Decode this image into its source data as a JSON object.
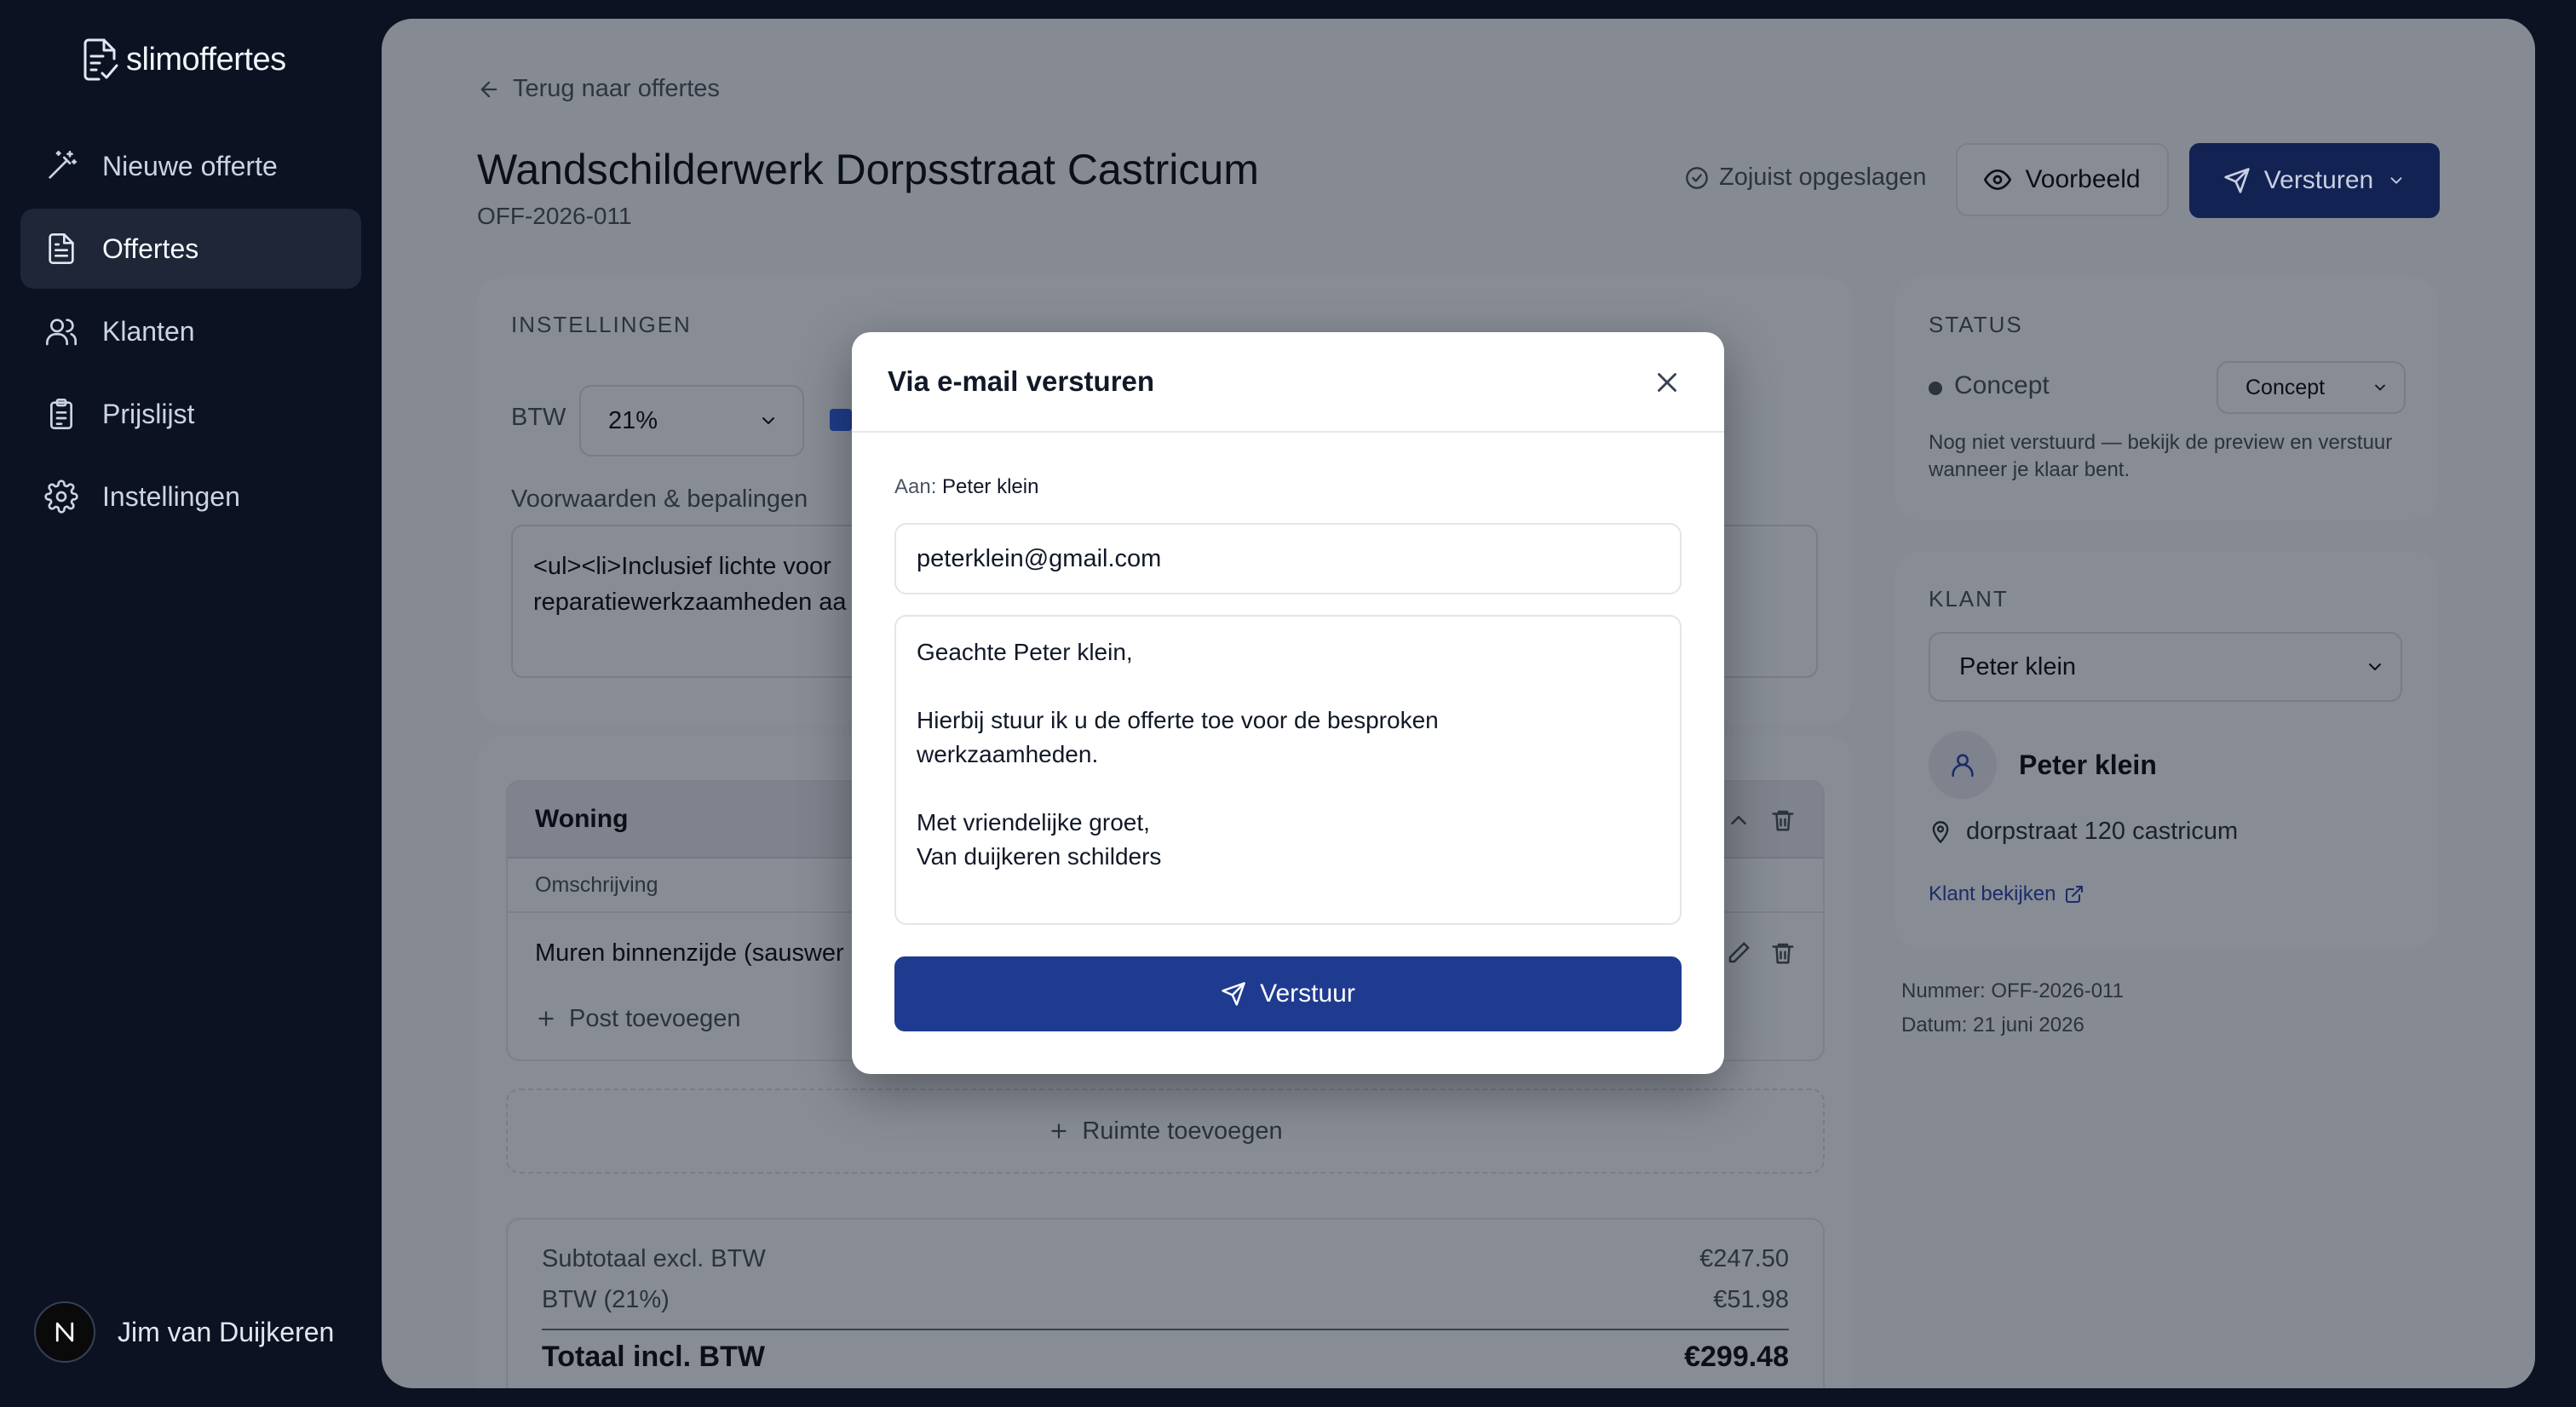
{
  "app": {
    "name": "slimoffertes"
  },
  "sidebar": {
    "items": [
      {
        "label": "Nieuwe offerte",
        "icon": "magic-wand-icon"
      },
      {
        "label": "Offertes",
        "icon": "document-icon",
        "active": true
      },
      {
        "label": "Klanten",
        "icon": "users-icon"
      },
      {
        "label": "Prijslijst",
        "icon": "clipboard-icon"
      },
      {
        "label": "Instellingen",
        "icon": "gear-icon"
      }
    ],
    "user": {
      "name": "Jim van Duijkeren",
      "avatar_letter": "N"
    }
  },
  "header": {
    "back_label": "Terug naar offertes",
    "title": "Wandschilderwerk Dorpsstraat Castricum",
    "number": "OFF-2026-011",
    "saved_status": "Zojuist opgeslagen",
    "preview_label": "Voorbeeld",
    "send_label": "Versturen"
  },
  "settings": {
    "section_label": "INSTELLINGEN",
    "btw_label": "BTW",
    "btw_value": "21%",
    "terms_label": "Voorwaarden & bepalingen",
    "terms_value": "<ul><li>Inclusief lichte voor\nreparatiewerkzaamheden aa"
  },
  "rooms": [
    {
      "name": "Woning",
      "column_header": "Omschrijving",
      "rows": [
        {
          "description": "Muren binnenzijde (sauswer"
        }
      ],
      "add_post_label": "Post toevoegen"
    }
  ],
  "add_room_label": "Ruimte toevoegen",
  "totals": {
    "subtotal_label": "Subtotaal excl. BTW",
    "subtotal_value": "€247.50",
    "btw_label": "BTW (21%)",
    "btw_value": "€51.98",
    "total_label": "Totaal incl. BTW",
    "total_value": "€299.48"
  },
  "status": {
    "section_label": "STATUS",
    "value": "Concept",
    "select_value": "Concept",
    "note": "Nog niet verstuurd — bekijk de preview en verstuur wanneer je klaar bent."
  },
  "client": {
    "section_label": "KLANT",
    "select_value": "Peter klein",
    "name": "Peter klein",
    "address": "dorpstraat 120 castricum",
    "view_link": "Klant bekijken"
  },
  "meta": {
    "number": "Nummer: OFF-2026-011",
    "date": "Datum: 21 juni 2026"
  },
  "modal": {
    "title": "Via e-mail versturen",
    "to_label": "Aan:",
    "to_name": "Peter klein",
    "email_value": "peterklein@gmail.com",
    "message_value": "Geachte Peter klein,\n\nHierbij stuur ik u de offerte toe voor de besproken\nwerkzaamheden.\n\nMet vriendelijke groet,\nVan duijkeren schilders",
    "submit_label": "Verstuur"
  },
  "colors": {
    "sidebar_bg": "#0c1222",
    "primary": "#1f3b8f",
    "modal_bg": "#ffffff"
  }
}
